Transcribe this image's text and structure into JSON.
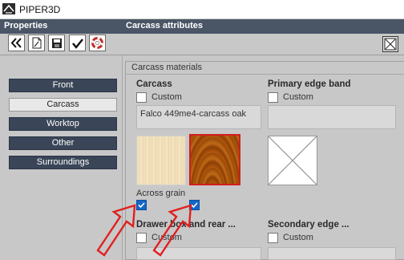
{
  "app": {
    "title": "PIPER3D"
  },
  "header": {
    "left": "Properties",
    "right": "Carcass attributes"
  },
  "toolbar": {
    "buttons": [
      {
        "name": "collapse",
        "icon": "double-chevron-left-icon"
      },
      {
        "name": "open",
        "icon": "open-document-icon"
      },
      {
        "name": "save",
        "icon": "floppy-disk-icon"
      },
      {
        "name": "accept",
        "icon": "checkmark-icon"
      },
      {
        "name": "help",
        "icon": "lifebuoy-icon"
      }
    ],
    "close_icon": "close-box-icon"
  },
  "nav": {
    "items": [
      {
        "label": "Front",
        "active": false
      },
      {
        "label": "Carcass",
        "active": true
      },
      {
        "label": "Worktop",
        "active": false
      },
      {
        "label": "Other",
        "active": false
      },
      {
        "label": "Surroundings",
        "active": false
      }
    ]
  },
  "materials": {
    "group_title": "Carcass materials",
    "carcass": {
      "title": "Carcass",
      "custom_label": "Custom",
      "custom_checked": false,
      "material_name": "Falco 449me4-carcass oak"
    },
    "primary_edge": {
      "title": "Primary edge band",
      "custom_label": "Custom",
      "custom_checked": false,
      "material_name": ""
    },
    "grain": {
      "label": "Across grain",
      "checkbox1_checked": true,
      "checkbox2_checked": true
    },
    "drawer_box": {
      "title": "Drawer box and rear ...",
      "custom_label": "Custom",
      "custom_checked": false
    },
    "secondary_edge": {
      "title": "Secondary edge ...",
      "custom_label": "Custom",
      "custom_checked": false
    }
  },
  "colors": {
    "nav_bg": "#3a4658",
    "header_bg": "#4a5566",
    "panel_bg": "#c8c8c8",
    "selection_border": "#d21e1e",
    "arrow": "#e02020",
    "checkbox_checked": "#1566c8"
  }
}
